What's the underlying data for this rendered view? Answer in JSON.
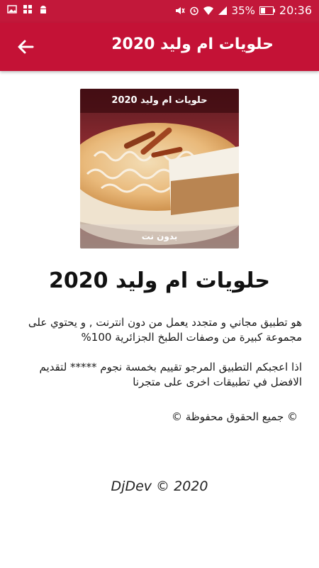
{
  "status_bar": {
    "battery_percent": "35%",
    "time": "20:36"
  },
  "app_bar": {
    "title": "حلويات ام وليد 2020",
    "back_icon": "arrow-back-icon"
  },
  "hero": {
    "caption_top": "حلويات ام وليد 2020",
    "caption_bottom": "بدون نت"
  },
  "main": {
    "heading": "حلويات ام وليد 2020",
    "description": [
      "هو تطبيق مجاني و متجدد يعمل من دون انترنت , و يحتوي على مجموعة كبيرة من وصفات الطبخ الجزائرية 100%",
      "اذا اعجبكم التطبيق المرجو تقييم  بخمسة نجوم ***** لتقديم الافضل في تطبيقات اخرى على متجرنا"
    ],
    "copyright": "© جميع الحقوق محفوظة ©",
    "footer": "DjDev © 2020"
  },
  "colors": {
    "app_bar": "#c41236",
    "status_bar": "#c2183a"
  }
}
